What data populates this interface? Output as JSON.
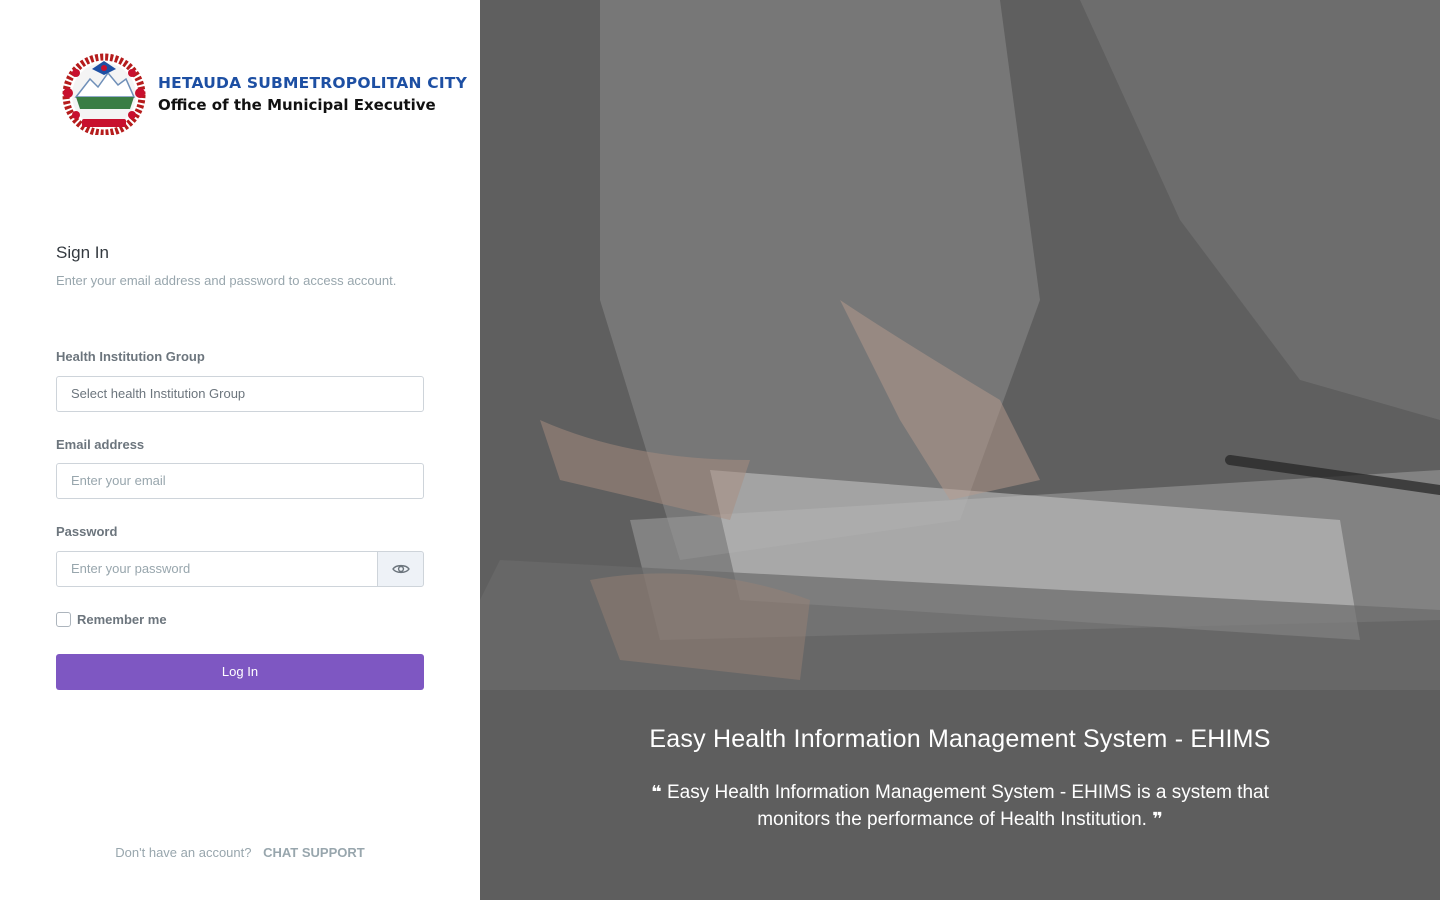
{
  "brand": {
    "line1": "HETAUDA SUBMETROPOLITAN CITY",
    "line2": "Office of the Municipal Executive",
    "colors": {
      "blue": "#1d4fa3",
      "red": "#c8102e"
    }
  },
  "signin": {
    "title": "Sign In",
    "subtitle": "Enter your email address and password to access account."
  },
  "fields": {
    "group_label": "Health Institution Group",
    "group_value": "Select health Institution Group",
    "email_label": "Email address",
    "email_placeholder": "Enter your email",
    "password_label": "Password",
    "password_placeholder": "Enter your password",
    "eye_icon": "eye-icon"
  },
  "remember_label": "Remember me",
  "login_label": "Log In",
  "footer": {
    "question": "Don't have an account?",
    "link": "CHAT SUPPORT"
  },
  "hero": {
    "title": "Easy Health Information Management System - EHIMS",
    "quote": "Easy Health Information Management System - EHIMS is a system that monitors the performance of Health Institution."
  },
  "colors": {
    "primary": "#7e57c2"
  }
}
